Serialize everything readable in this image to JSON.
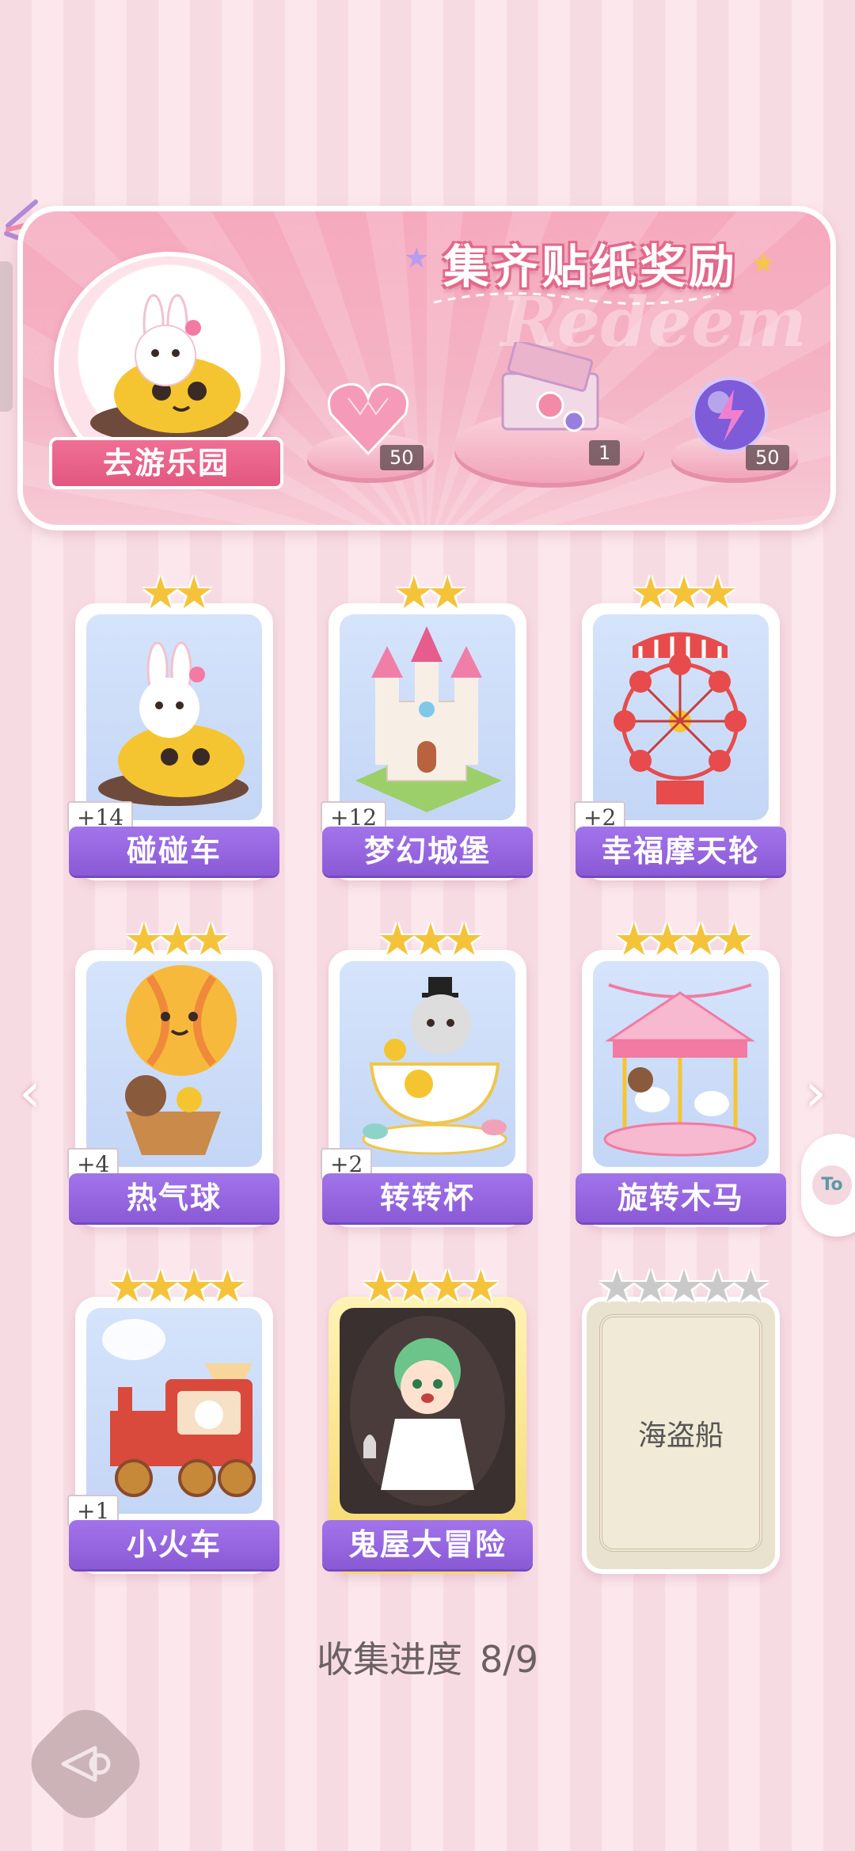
{
  "banner": {
    "title": "集齐贴纸奖励",
    "watermark": "Redeem",
    "park_button": "去游乐园",
    "rewards": [
      {
        "icon": "pink-heart-gem-icon",
        "count": "50"
      },
      {
        "icon": "gift-box-icon",
        "count": "1"
      },
      {
        "icon": "lightning-orb-icon",
        "count": "50"
      }
    ]
  },
  "cards": [
    {
      "name": "碰碰车",
      "stars": "★★",
      "plus": "+14",
      "icon": "bumper-car-icon"
    },
    {
      "name": "梦幻城堡",
      "stars": "★★",
      "plus": "+12",
      "icon": "castle-icon"
    },
    {
      "name": "幸福摩天轮",
      "stars": "★★★",
      "plus": "+2",
      "icon": "ferris-wheel-icon"
    },
    {
      "name": "热气球",
      "stars": "★★★",
      "plus": "+4",
      "icon": "hot-air-balloon-icon"
    },
    {
      "name": "转转杯",
      "stars": "★★★",
      "plus": "+2",
      "icon": "teacup-icon"
    },
    {
      "name": "旋转木马",
      "stars": "★★★★",
      "plus": "",
      "icon": "carousel-icon"
    },
    {
      "name": "小火车",
      "stars": "★★★★",
      "plus": "+1",
      "icon": "train-icon"
    },
    {
      "name": "鬼屋大冒险",
      "stars": "★★★★",
      "plus": "",
      "icon": "haunted-house-icon"
    },
    {
      "name": "海盗船",
      "stars": "★★★★★",
      "plus": "",
      "icon": "pirate-ship-icon",
      "locked": true
    }
  ],
  "progress": {
    "label": "收集进度",
    "value": "8/9"
  },
  "side_bubble": "To"
}
